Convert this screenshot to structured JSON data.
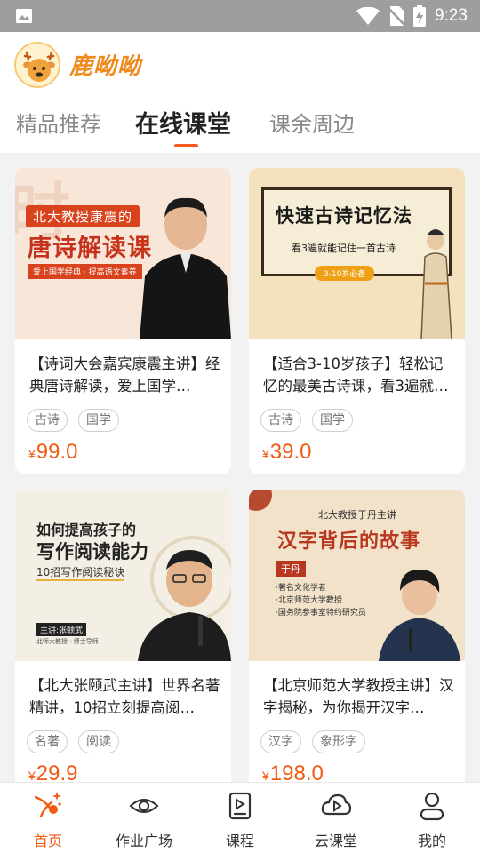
{
  "status_bar": {
    "time": "9:23"
  },
  "app": {
    "brand": "鹿呦呦"
  },
  "tabs": [
    {
      "label": "精品推荐"
    },
    {
      "label": "在线课堂"
    },
    {
      "label": "课余周边"
    }
  ],
  "courses": [
    {
      "title": "【诗词大会嘉宾康震主讲】经典唐诗解读，爱上国学…",
      "tags": [
        "古诗",
        "国学"
      ],
      "currency": "¥",
      "price": "99.0",
      "cover": {
        "ribbon": "北大教授康震的",
        "headline": "唐诗解读课",
        "sub": "爱上国学经典 · 提高语文素养",
        "bg_glyph": "时"
      }
    },
    {
      "title": "【适合3-10岁孩子】轻松记忆的最美古诗课，看3遍就…",
      "tags": [
        "古诗",
        "国学"
      ],
      "currency": "¥",
      "price": "39.0",
      "cover": {
        "headline": "快速古诗记忆法",
        "sub": "看3遍就能记住一首古诗",
        "badge": "3-10岁必备"
      }
    },
    {
      "title": "【北大张颐武主讲】世界名著精讲，10招立刻提高阅…",
      "tags": [
        "名著",
        "阅读"
      ],
      "currency": "¥",
      "price": "29.9",
      "cover": {
        "headline1": "如何提高孩子的",
        "headline2": "写作阅读能力",
        "sub": "10招写作阅读秘诀",
        "speaker": "主讲:张颐武",
        "speaker_sub": "北师大教授 · 博士导师"
      }
    },
    {
      "title": "【北京师范大学教授主讲】汉字揭秘，为你揭开汉字…",
      "tags": [
        "汉字",
        "象形字"
      ],
      "currency": "¥",
      "price": "198.0",
      "cover": {
        "top": "北大教授于丹主讲",
        "headline": "汉字背后的故事",
        "name": "于丹",
        "bullets": [
          "·著名文化学者",
          "·北京师范大学教授",
          "·国务院参事室特约研究员"
        ]
      }
    }
  ],
  "bottom_nav": [
    {
      "label": "首页"
    },
    {
      "label": "作业广场"
    },
    {
      "label": "课程"
    },
    {
      "label": "云课堂"
    },
    {
      "label": "我的"
    }
  ],
  "colors": {
    "accent": "#f05a12",
    "brand": "#ef8a1c",
    "statusbar": "#9e9e9e"
  }
}
